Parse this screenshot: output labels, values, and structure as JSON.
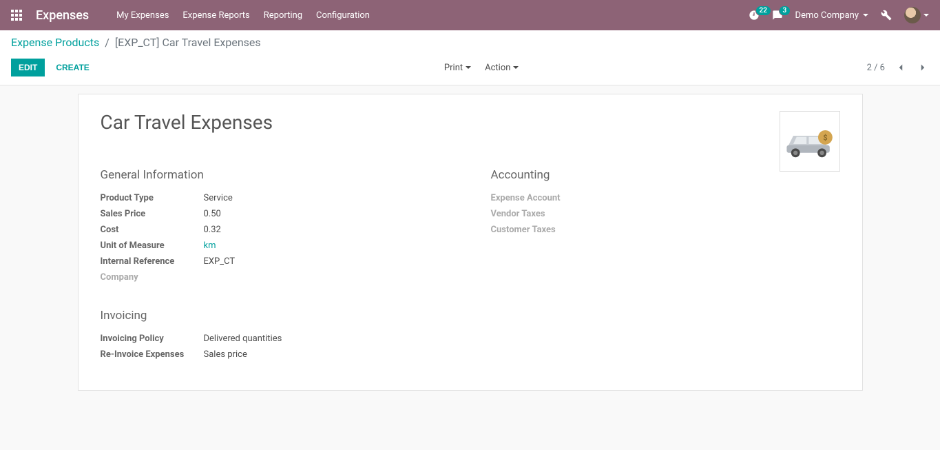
{
  "topbar": {
    "brand": "Expenses",
    "nav": [
      "My Expenses",
      "Expense Reports",
      "Reporting",
      "Configuration"
    ],
    "clock_badge": "22",
    "msg_badge": "3",
    "company": "Demo Company"
  },
  "breadcrumb": {
    "parent": "Expense Products",
    "separator": "/",
    "current": "[EXP_CT] Car Travel Expenses"
  },
  "buttons": {
    "edit": "Edit",
    "create": "Create"
  },
  "toolbar": {
    "print": "Print",
    "action": "Action"
  },
  "pager": {
    "text": "2 / 6"
  },
  "record": {
    "title": "Car Travel Expenses",
    "sections": {
      "general": {
        "title": "General Information",
        "fields": {
          "product_type": {
            "label": "Product Type",
            "value": "Service"
          },
          "sales_price": {
            "label": "Sales Price",
            "value": "0.50"
          },
          "cost": {
            "label": "Cost",
            "value": "0.32"
          },
          "uom": {
            "label": "Unit of Measure",
            "value": "km"
          },
          "internal_ref": {
            "label": "Internal Reference",
            "value": "EXP_CT"
          },
          "company": {
            "label": "Company",
            "value": ""
          }
        }
      },
      "invoicing": {
        "title": "Invoicing",
        "fields": {
          "invoicing_policy": {
            "label": "Invoicing Policy",
            "value": "Delivered quantities"
          },
          "reinvoice": {
            "label": "Re-Invoice Expenses",
            "value": "Sales price"
          }
        }
      },
      "accounting": {
        "title": "Accounting",
        "fields": {
          "expense_account": {
            "label": "Expense Account",
            "value": ""
          },
          "vendor_taxes": {
            "label": "Vendor Taxes",
            "value": ""
          },
          "customer_taxes": {
            "label": "Customer Taxes",
            "value": ""
          }
        }
      }
    }
  }
}
